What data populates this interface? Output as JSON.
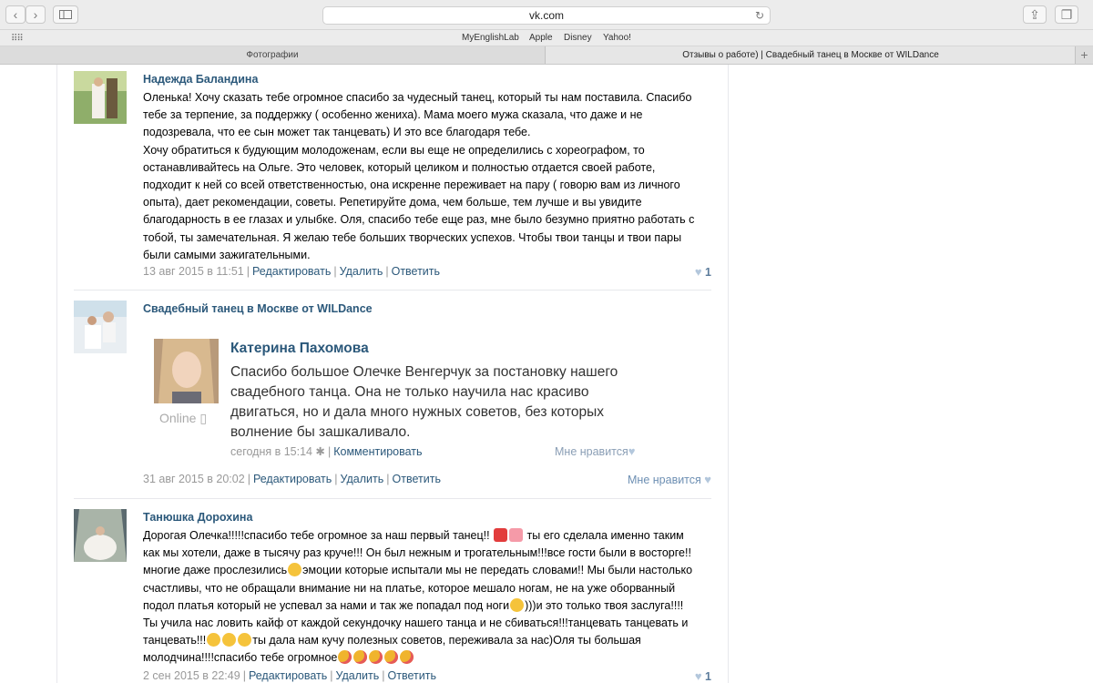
{
  "browser": {
    "url": "vk.com",
    "favorites": [
      "MyEnglishLab",
      "Apple",
      "Disney",
      "Yahoo!"
    ],
    "tabs": [
      "Фотографии",
      "Отзывы о работе) | Свадебный танец в Москве от WILDance"
    ]
  },
  "posts": [
    {
      "author": "Надежда Баландина",
      "text": "Оленька! Хочу сказать тебе огромное спасибо за чудесный танец, который ты нам поставила. Спасибо тебе за терпение, за поддержку ( особенно жениха). Мама моего мужа сказала, что даже и не подозревала, что ее сын может так танцевать) И это все благодаря тебе.\nХочу обратиться к будующим молодоженам, если вы еще не определились с хореографом, то останавливайтесь на Ольге. Это человек, который целиком и полностью отдается своей работе, подходит к ней со всей ответственностью, она искренне переживает на пару ( говорю вам из личного опыта), дает рекомендации, советы. Репетируйте дома, чем больше, тем лучше и вы увидите благодарность в ее глазах и улыбке. Оля, спасибо тебе еще раз, мне было безумно приятно работать с тобой, ты замечательная. Я желаю тебе больших творческих успехов. Чтобы твои танцы и твои пары были самыми зажигательными.",
      "date": "13 авг 2015 в 11:51",
      "edit": "Редактировать",
      "delete": "Удалить",
      "reply": "Ответить",
      "likes": "1"
    },
    {
      "author": "Свадебный танец в Москве от WILDance",
      "date": "31 авг 2015 в 20:02",
      "edit": "Редактировать",
      "delete": "Удалить",
      "reply": "Ответить",
      "likes": "Мне нравится"
    },
    {
      "author": "Танюшка Дорохина",
      "text_parts": [
        "Дорогая Олечка!!!!!спасибо тебе огромное за наш первый танец!! ",
        " ты его сделала именно таким как мы хотели, даже в тысячу раз круче!!! Он был нежным и трогательным!!!все гости были в восторге!!многие даже прослезились",
        "эмоции которые испытали мы не передать словами!! Мы были настолько счастливы, что не обращали внимание ни на платье, которое мешало ногам, не на уже оборванный подол платья который не успевал за нами и так же попадал под ноги",
        ")))и это только твоя заслуга!!!! Ты учила нас ловить кайф от каждой секундочку нашего танца и не сбиваться!!!танцевать танцевать и танцевать!!!",
        "ты дала нам кучу полезных советов, переживала за нас)Оля ты большая молодчина!!!!спасибо тебе огромное"
      ],
      "date": "2 сен 2015 в 22:49",
      "edit": "Редактировать",
      "delete": "Удалить",
      "reply": "Ответить",
      "likes": "1"
    }
  ],
  "repost": {
    "name": "Катерина Пахомова",
    "online": "Online",
    "text": "Спасибо большое Олечке Венгерчук за постановку нашего свадебного танца. Она не только научила нас красиво двигаться, но и дала много нужных советов, без которых волнение бы зашкаливало.",
    "date": "сегодня в 15:14",
    "comment": "Комментировать",
    "like": "Мне нравится"
  },
  "colors": {
    "link": "#2b587a",
    "meta": "#999999",
    "divider": "#e7e8ec"
  }
}
